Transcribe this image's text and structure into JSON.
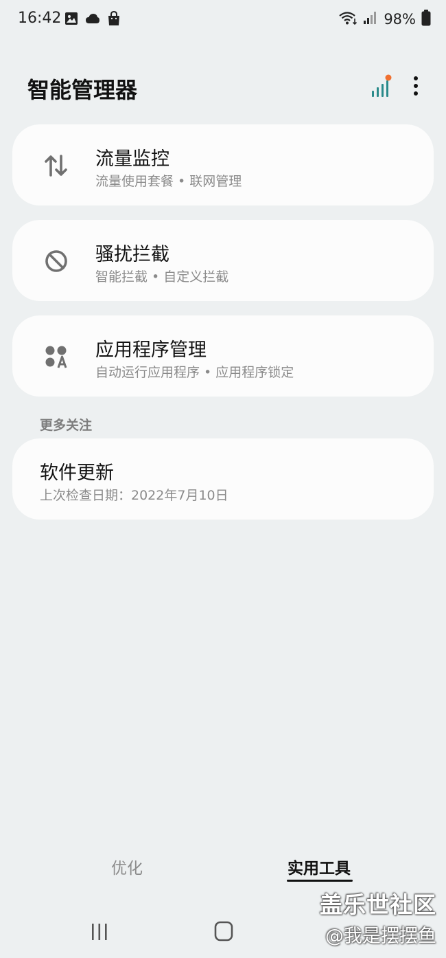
{
  "status_bar": {
    "time": "16:42",
    "battery": "98%",
    "left_icons": [
      "image-icon",
      "cloud-icon",
      "shopping-bag-icon"
    ],
    "right_icons": [
      "wifi-icon",
      "signal-icon",
      "battery-icon"
    ]
  },
  "header": {
    "title": "智能管理器",
    "actions": [
      "data-usage-icon",
      "more-options-icon"
    ],
    "accent_dot_color": "#f07030",
    "chart_icon_color": "#2a8a8a"
  },
  "cards": [
    {
      "title": "流量监控",
      "subtitle": "流量使用套餐 • 联网管理",
      "icon": "data-transfer-icon"
    },
    {
      "title": "骚扰拦截",
      "subtitle": "智能拦截 • 自定义拦截",
      "icon": "block-icon"
    },
    {
      "title": "应用程序管理",
      "subtitle": "自动运行应用程序 • 应用程序锁定",
      "icon": "apps-icon"
    }
  ],
  "section": {
    "label": "更多关注",
    "item": {
      "title": "软件更新",
      "subtitle": "上次检查日期：2022年7月10日"
    }
  },
  "tabs": [
    {
      "label": "优化",
      "selected": false
    },
    {
      "label": "实用工具",
      "selected": true
    }
  ],
  "nav": [
    "recent-apps-icon",
    "home-icon"
  ],
  "watermark": {
    "line1": "盖乐世社区",
    "line2": "@我是摆摆鱼"
  }
}
